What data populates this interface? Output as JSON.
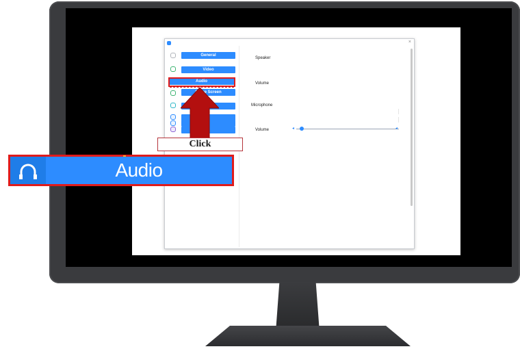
{
  "settings_window": {
    "sidebar": {
      "items": [
        {
          "label": "General",
          "icon": "gear-icon"
        },
        {
          "label": "Video",
          "icon": "video-icon"
        },
        {
          "label": "Audio",
          "icon": "headphones-icon",
          "selected": true
        },
        {
          "label": "Share Screen",
          "icon": "share-screen-icon"
        },
        {
          "label": "",
          "icon": "chat-icon"
        },
        {
          "label": "",
          "icon": "background-icon"
        },
        {
          "label": "",
          "icon": "recording-icon"
        },
        {
          "label": "",
          "icon": "profile-icon"
        }
      ]
    },
    "audio_panel": {
      "speaker_label": "Speaker",
      "speaker_volume_label": "Volume",
      "microphone_label": "Microphone",
      "microphone_volume_label": "Volume",
      "microphone_volume_level": 0.05
    }
  },
  "callout": {
    "click_label": "Click",
    "zoomed_button_label": "Audio",
    "highlight_color": "#e01b1b",
    "arrow_color": "#b30f0f"
  },
  "colors": {
    "accent": "#2d8cff",
    "bezel": "#3a3b3e"
  }
}
